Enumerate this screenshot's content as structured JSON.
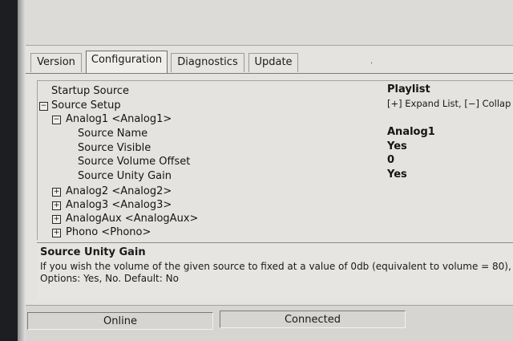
{
  "tabs": [
    {
      "label": "Version",
      "active": false
    },
    {
      "label": "Configuration",
      "active": true
    },
    {
      "label": "Diagnostics",
      "active": false
    },
    {
      "label": "Update",
      "active": false
    }
  ],
  "tab_dot": "·",
  "tree": {
    "startup_source": {
      "label": "Startup Source",
      "value": "Playlist"
    },
    "source_setup": {
      "label": "Source Setup",
      "expander": "−"
    },
    "expand_hint": "[+] Expand List,  [−] Collap",
    "analog1": {
      "label": "Analog1   <Analog1>",
      "expander": "−",
      "properties": [
        {
          "label": "Source Name",
          "value": "Analog1"
        },
        {
          "label": "Source Visible",
          "value": "Yes"
        },
        {
          "label": "Source Volume Offset",
          "value": "0"
        },
        {
          "label": "Source Unity Gain",
          "value": "Yes"
        }
      ]
    },
    "collapsed_sources": [
      {
        "label": "Analog2   <Analog2>",
        "expander": "+"
      },
      {
        "label": "Analog3   <Analog3>",
        "expander": "+"
      },
      {
        "label": "AnalogAux   <AnalogAux>",
        "expander": "+"
      },
      {
        "label": "Phono   <Phono>",
        "expander": "+"
      }
    ]
  },
  "description": {
    "title": "Source Unity Gain",
    "line1": "If you wish the volume of the given source to fixed at a value of 0db (equivalent to volume = 80), s",
    "line2": "Options: Yes, No. Default: No"
  },
  "status": {
    "online": "Online",
    "connected": "Connected"
  },
  "colors": {
    "window_bg": "#e4e3e0",
    "desktop_bg": "#1c1e22"
  }
}
